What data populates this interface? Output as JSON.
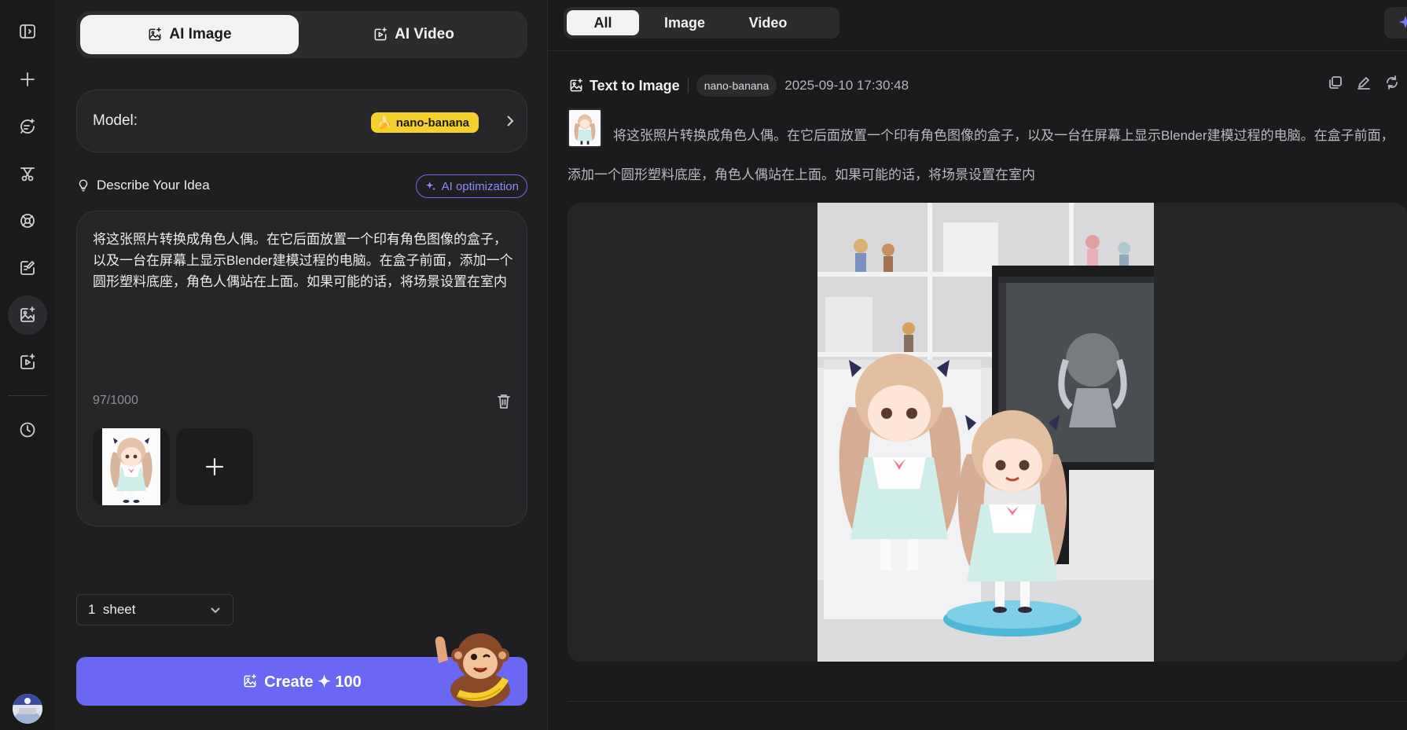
{
  "modes": {
    "ai_image": "AI Image",
    "ai_video": "AI Video"
  },
  "model": {
    "label": "Model:",
    "value": "nano-banana",
    "badge_color": "#f5cf2b"
  },
  "describe": {
    "label": "Describe Your Idea",
    "ai_optimization": "AI optimization"
  },
  "prompt": {
    "text": "将这张照片转换成角色人偶。在它后面放置一个印有角色图像的盒子，以及一台在屏幕上显示Blender建模过程的电脑。在盒子前面，添加一个圆形塑料底座，角色人偶站在上面。如果可能的话，将场景设置在室内",
    "count": "97/1000"
  },
  "sheets": {
    "value": "1  sheet"
  },
  "create": {
    "label": "Create ✦ 100"
  },
  "filters": {
    "all": "All",
    "image": "Image",
    "video": "Video"
  },
  "entry": {
    "type": "Text to Image",
    "model": "nano-banana",
    "timestamp": "2025-09-10 17:30:48",
    "prompt": "将这张照片转换成角色人偶。在它后面放置一个印有角色图像的盒子，以及一台在屏幕上显示Blender建模过程的电脑。在盒子前面，添加一个圆形塑料底座，角色人偶站在上面。如果可能的话，将场景设置在室内"
  },
  "colors": {
    "accent": "#6b67f5",
    "ai_opt": "#8e8bff",
    "background": "#1b1b1d"
  },
  "icons": {
    "sidebar": [
      "panel-toggle-icon",
      "plus-icon",
      "chat-sparkle-icon",
      "scissors-icon",
      "grid-icon",
      "edit-image-icon",
      "image-icon",
      "video-icon",
      "history-icon"
    ]
  }
}
